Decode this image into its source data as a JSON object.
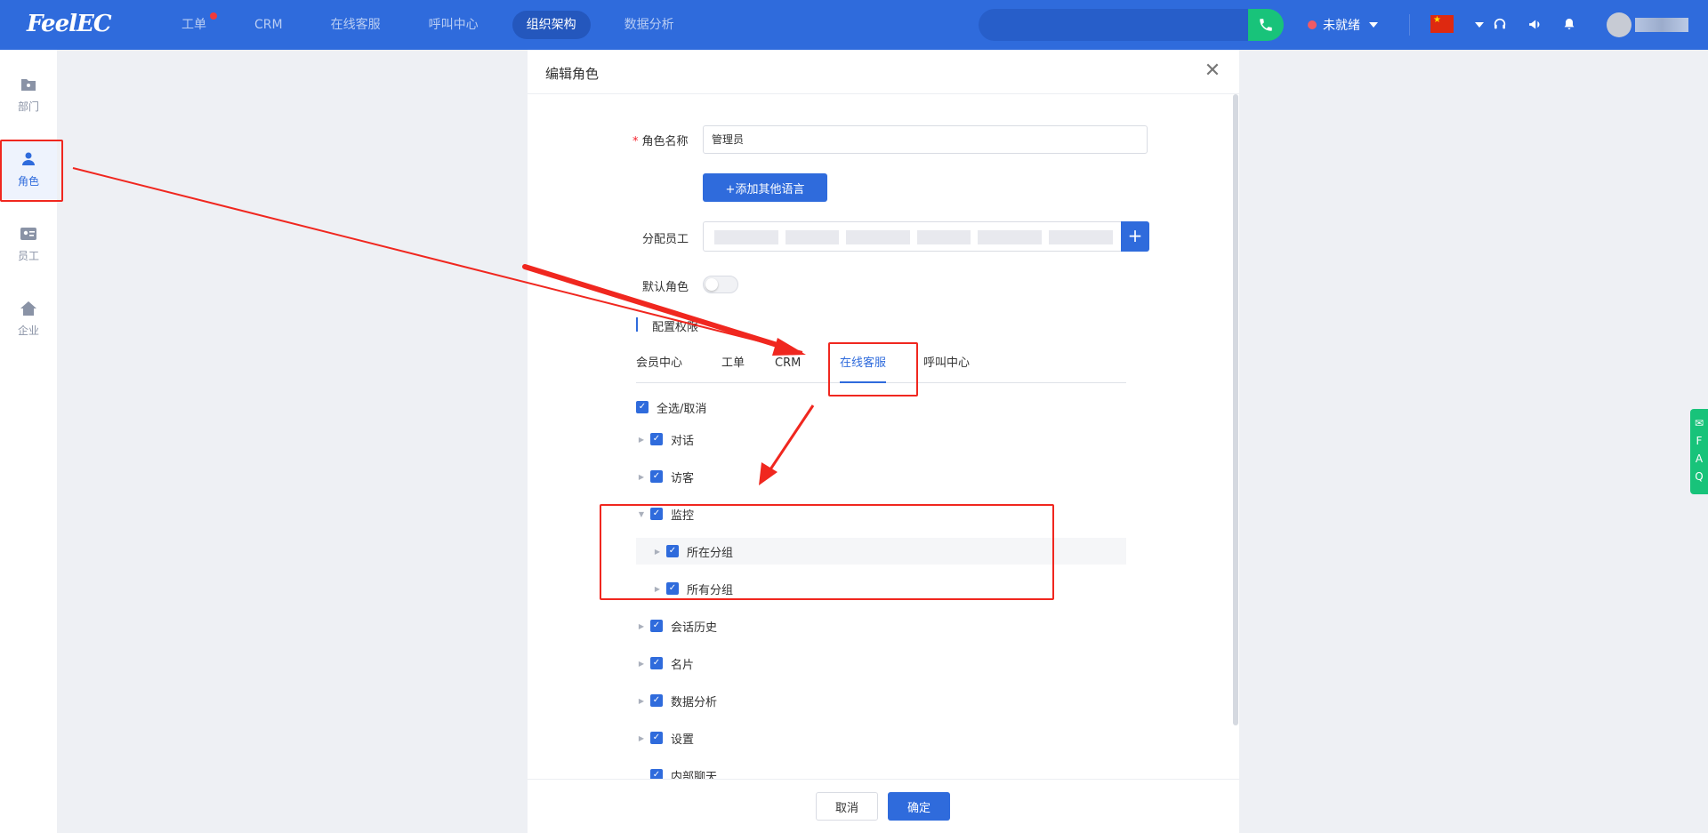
{
  "topbar": {
    "logo": "FeelEC",
    "nav": [
      {
        "label": "工单",
        "badge": true
      },
      {
        "label": "CRM"
      },
      {
        "label": "在线客服"
      },
      {
        "label": "呼叫中心"
      },
      {
        "label": "组织架构",
        "active": true
      },
      {
        "label": "数据分析"
      }
    ],
    "status_label": "未就绪",
    "flag_glyph": "★"
  },
  "sidebar": {
    "items": [
      {
        "label": "部门",
        "icon": "folder-icon"
      },
      {
        "label": "角色",
        "icon": "user-icon",
        "active": true
      },
      {
        "label": "员工",
        "icon": "id-card-icon"
      },
      {
        "label": "企业",
        "icon": "home-icon"
      }
    ]
  },
  "modal": {
    "title": "编辑角色",
    "role_name_label": "角色名称",
    "role_name_value": "管理员",
    "add_language_button": "+添加其他语言",
    "assign_label": "分配员工",
    "default_role_label": "默认角色",
    "config_label": "配置权限",
    "tabs": [
      "会员中心",
      "工单",
      "CRM",
      "在线客服",
      "呼叫中心"
    ],
    "active_tab": "在线客服",
    "select_all": "全选/取消",
    "tree": [
      {
        "label": "对话",
        "level": 1
      },
      {
        "label": "访客",
        "level": 1
      },
      {
        "label": "监控",
        "level": 1,
        "expanded": true
      },
      {
        "label": "所在分组",
        "level": 2
      },
      {
        "label": "所有分组",
        "level": 2
      },
      {
        "label": "会话历史",
        "level": 1
      },
      {
        "label": "名片",
        "level": 1
      },
      {
        "label": "数据分析",
        "level": 1
      },
      {
        "label": "设置",
        "level": 1
      },
      {
        "label": "内部聊天",
        "level": 1
      }
    ],
    "cancel_button": "取消",
    "confirm_button": "确定"
  },
  "faq": {
    "letters": [
      "F",
      "A",
      "Q"
    ]
  },
  "colors": {
    "primary": "#2f6bdc",
    "topbar": "#2f6bdc",
    "call_green": "#18c37a",
    "annotation_red": "#f0271f"
  }
}
